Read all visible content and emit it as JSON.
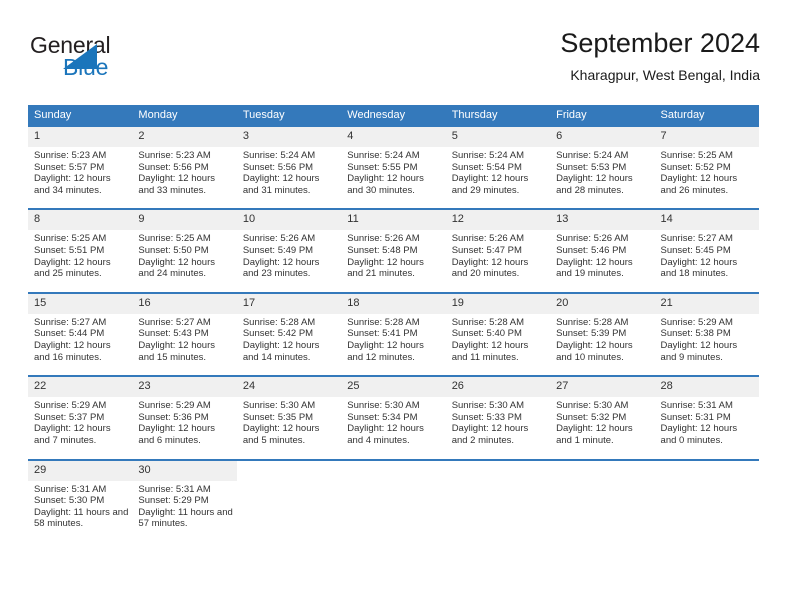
{
  "brand": {
    "name_part1": "General",
    "name_part2": "Blue"
  },
  "header": {
    "title": "September 2024",
    "subtitle": "Kharagpur, West Bengal, India"
  },
  "colors": {
    "header_blue": "#3479bb",
    "brand_blue": "#1b75bb",
    "day_band": "#f0f0f0"
  },
  "weekdays": [
    "Sunday",
    "Monday",
    "Tuesday",
    "Wednesday",
    "Thursday",
    "Friday",
    "Saturday"
  ],
  "weeks": [
    [
      {
        "day": "1",
        "sunrise": "Sunrise: 5:23 AM",
        "sunset": "Sunset: 5:57 PM",
        "daylight": "Daylight: 12 hours and 34 minutes."
      },
      {
        "day": "2",
        "sunrise": "Sunrise: 5:23 AM",
        "sunset": "Sunset: 5:56 PM",
        "daylight": "Daylight: 12 hours and 33 minutes."
      },
      {
        "day": "3",
        "sunrise": "Sunrise: 5:24 AM",
        "sunset": "Sunset: 5:56 PM",
        "daylight": "Daylight: 12 hours and 31 minutes."
      },
      {
        "day": "4",
        "sunrise": "Sunrise: 5:24 AM",
        "sunset": "Sunset: 5:55 PM",
        "daylight": "Daylight: 12 hours and 30 minutes."
      },
      {
        "day": "5",
        "sunrise": "Sunrise: 5:24 AM",
        "sunset": "Sunset: 5:54 PM",
        "daylight": "Daylight: 12 hours and 29 minutes."
      },
      {
        "day": "6",
        "sunrise": "Sunrise: 5:24 AM",
        "sunset": "Sunset: 5:53 PM",
        "daylight": "Daylight: 12 hours and 28 minutes."
      },
      {
        "day": "7",
        "sunrise": "Sunrise: 5:25 AM",
        "sunset": "Sunset: 5:52 PM",
        "daylight": "Daylight: 12 hours and 26 minutes."
      }
    ],
    [
      {
        "day": "8",
        "sunrise": "Sunrise: 5:25 AM",
        "sunset": "Sunset: 5:51 PM",
        "daylight": "Daylight: 12 hours and 25 minutes."
      },
      {
        "day": "9",
        "sunrise": "Sunrise: 5:25 AM",
        "sunset": "Sunset: 5:50 PM",
        "daylight": "Daylight: 12 hours and 24 minutes."
      },
      {
        "day": "10",
        "sunrise": "Sunrise: 5:26 AM",
        "sunset": "Sunset: 5:49 PM",
        "daylight": "Daylight: 12 hours and 23 minutes."
      },
      {
        "day": "11",
        "sunrise": "Sunrise: 5:26 AM",
        "sunset": "Sunset: 5:48 PM",
        "daylight": "Daylight: 12 hours and 21 minutes."
      },
      {
        "day": "12",
        "sunrise": "Sunrise: 5:26 AM",
        "sunset": "Sunset: 5:47 PM",
        "daylight": "Daylight: 12 hours and 20 minutes."
      },
      {
        "day": "13",
        "sunrise": "Sunrise: 5:26 AM",
        "sunset": "Sunset: 5:46 PM",
        "daylight": "Daylight: 12 hours and 19 minutes."
      },
      {
        "day": "14",
        "sunrise": "Sunrise: 5:27 AM",
        "sunset": "Sunset: 5:45 PM",
        "daylight": "Daylight: 12 hours and 18 minutes."
      }
    ],
    [
      {
        "day": "15",
        "sunrise": "Sunrise: 5:27 AM",
        "sunset": "Sunset: 5:44 PM",
        "daylight": "Daylight: 12 hours and 16 minutes."
      },
      {
        "day": "16",
        "sunrise": "Sunrise: 5:27 AM",
        "sunset": "Sunset: 5:43 PM",
        "daylight": "Daylight: 12 hours and 15 minutes."
      },
      {
        "day": "17",
        "sunrise": "Sunrise: 5:28 AM",
        "sunset": "Sunset: 5:42 PM",
        "daylight": "Daylight: 12 hours and 14 minutes."
      },
      {
        "day": "18",
        "sunrise": "Sunrise: 5:28 AM",
        "sunset": "Sunset: 5:41 PM",
        "daylight": "Daylight: 12 hours and 12 minutes."
      },
      {
        "day": "19",
        "sunrise": "Sunrise: 5:28 AM",
        "sunset": "Sunset: 5:40 PM",
        "daylight": "Daylight: 12 hours and 11 minutes."
      },
      {
        "day": "20",
        "sunrise": "Sunrise: 5:28 AM",
        "sunset": "Sunset: 5:39 PM",
        "daylight": "Daylight: 12 hours and 10 minutes."
      },
      {
        "day": "21",
        "sunrise": "Sunrise: 5:29 AM",
        "sunset": "Sunset: 5:38 PM",
        "daylight": "Daylight: 12 hours and 9 minutes."
      }
    ],
    [
      {
        "day": "22",
        "sunrise": "Sunrise: 5:29 AM",
        "sunset": "Sunset: 5:37 PM",
        "daylight": "Daylight: 12 hours and 7 minutes."
      },
      {
        "day": "23",
        "sunrise": "Sunrise: 5:29 AM",
        "sunset": "Sunset: 5:36 PM",
        "daylight": "Daylight: 12 hours and 6 minutes."
      },
      {
        "day": "24",
        "sunrise": "Sunrise: 5:30 AM",
        "sunset": "Sunset: 5:35 PM",
        "daylight": "Daylight: 12 hours and 5 minutes."
      },
      {
        "day": "25",
        "sunrise": "Sunrise: 5:30 AM",
        "sunset": "Sunset: 5:34 PM",
        "daylight": "Daylight: 12 hours and 4 minutes."
      },
      {
        "day": "26",
        "sunrise": "Sunrise: 5:30 AM",
        "sunset": "Sunset: 5:33 PM",
        "daylight": "Daylight: 12 hours and 2 minutes."
      },
      {
        "day": "27",
        "sunrise": "Sunrise: 5:30 AM",
        "sunset": "Sunset: 5:32 PM",
        "daylight": "Daylight: 12 hours and 1 minute."
      },
      {
        "day": "28",
        "sunrise": "Sunrise: 5:31 AM",
        "sunset": "Sunset: 5:31 PM",
        "daylight": "Daylight: 12 hours and 0 minutes."
      }
    ],
    [
      {
        "day": "29",
        "sunrise": "Sunrise: 5:31 AM",
        "sunset": "Sunset: 5:30 PM",
        "daylight": "Daylight: 11 hours and 58 minutes."
      },
      {
        "day": "30",
        "sunrise": "Sunrise: 5:31 AM",
        "sunset": "Sunset: 5:29 PM",
        "daylight": "Daylight: 11 hours and 57 minutes."
      },
      {
        "day": "",
        "sunrise": "",
        "sunset": "",
        "daylight": ""
      },
      {
        "day": "",
        "sunrise": "",
        "sunset": "",
        "daylight": ""
      },
      {
        "day": "",
        "sunrise": "",
        "sunset": "",
        "daylight": ""
      },
      {
        "day": "",
        "sunrise": "",
        "sunset": "",
        "daylight": ""
      },
      {
        "day": "",
        "sunrise": "",
        "sunset": "",
        "daylight": ""
      }
    ]
  ]
}
